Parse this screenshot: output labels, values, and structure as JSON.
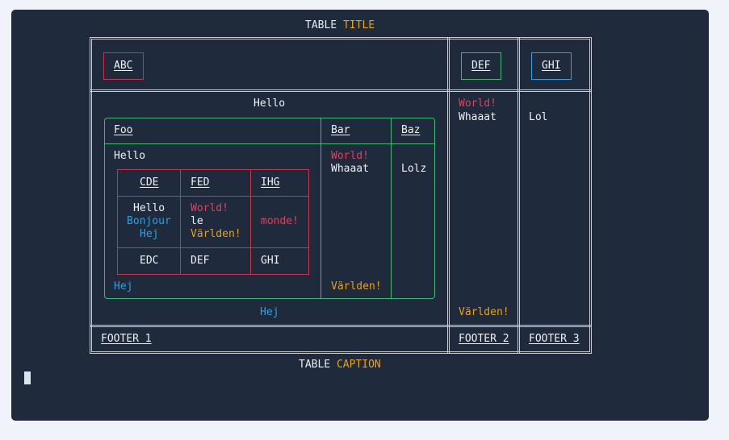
{
  "title": {
    "word1": "TABLE",
    "word2": "TITLE"
  },
  "caption": {
    "word1": "TABLE",
    "word2": "CAPTION"
  },
  "header": {
    "abc": "ABC",
    "def": "DEF",
    "ghi": "GHI"
  },
  "outer_body": {
    "hello": "Hello",
    "hej": "Hej",
    "col2": {
      "world": "World!",
      "whaaat": "Whaaat",
      "varlden": "Världen!"
    },
    "col3": {
      "lol": "Lol"
    }
  },
  "middle_table": {
    "headers": [
      "Foo",
      "Bar",
      "Baz"
    ],
    "hello": "Hello",
    "hej": "Hej",
    "bar": {
      "world": "World!",
      "whaaat": "Whaaat",
      "varlden": "Världen!"
    },
    "baz": "Lolz"
  },
  "inner_table": {
    "headers": [
      "CDE",
      "FED",
      "IHG"
    ],
    "row1": {
      "c1": [
        "Hello",
        "Bonjour",
        "Hej"
      ],
      "c2": [
        "World!",
        "le",
        "Världen!"
      ],
      "c3": "monde!"
    },
    "row2": [
      "EDC",
      "DEF",
      "GHI"
    ]
  },
  "footer": [
    "FOOTER 1",
    "FOOTER 2",
    "FOOTER 3"
  ],
  "colors": {
    "background": "#1f2a3c",
    "yellow": "#e5a11e",
    "red": "#e0405e",
    "blue": "#2f9fe0",
    "green": "#3fb96f",
    "border": "#c9ccd3"
  }
}
